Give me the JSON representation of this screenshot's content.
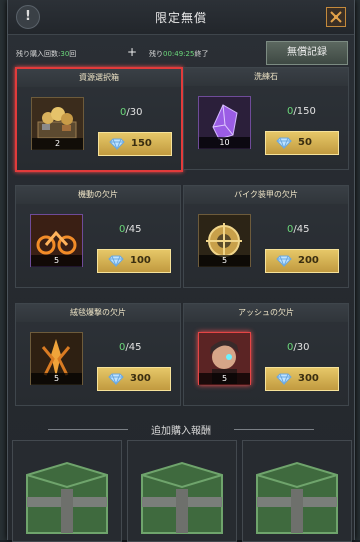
{
  "header": {
    "info_icon": "!",
    "title": "限定無償",
    "close_icon": "close-icon"
  },
  "subbar": {
    "remaining_purchases_label": "残り購入回数:",
    "remaining_purchases_value": "30",
    "remaining_purchases_unit": "回",
    "plus": "+",
    "timer_prefix": "残り",
    "timer_value": "00:49:25",
    "timer_suffix": "終了",
    "record_button": "無償記録"
  },
  "cards": [
    {
      "name": "資源選択箱",
      "current": "0",
      "max": "/30",
      "qty": "2",
      "price": "150",
      "selected": true,
      "icon": "resource-box-icon"
    },
    {
      "name": "洗練石",
      "current": "0",
      "max": "/150",
      "qty": "10",
      "price": "50",
      "selected": false,
      "icon": "crystal-icon"
    },
    {
      "name": "機動の欠片",
      "current": "0",
      "max": "/45",
      "qty": "5",
      "price": "100",
      "selected": false,
      "icon": "bike-shard-icon"
    },
    {
      "name": "バイク装甲の欠片",
      "current": "0",
      "max": "/45",
      "qty": "5",
      "price": "200",
      "selected": false,
      "icon": "armor-shard-icon"
    },
    {
      "name": "絨毯爆撃の欠片",
      "current": "0",
      "max": "/45",
      "qty": "5",
      "price": "300",
      "selected": false,
      "icon": "bombing-shard-icon"
    },
    {
      "name": "アッシュの欠片",
      "current": "0",
      "max": "/30",
      "qty": "5",
      "price": "300",
      "selected": false,
      "icon": "ash-portrait-icon"
    }
  ],
  "bonus": {
    "title": "追加購入報酬"
  },
  "colors": {
    "accent_gold": "#e6c768",
    "highlight_red": "#e23b3b",
    "progress_green": "#6bd77a"
  }
}
